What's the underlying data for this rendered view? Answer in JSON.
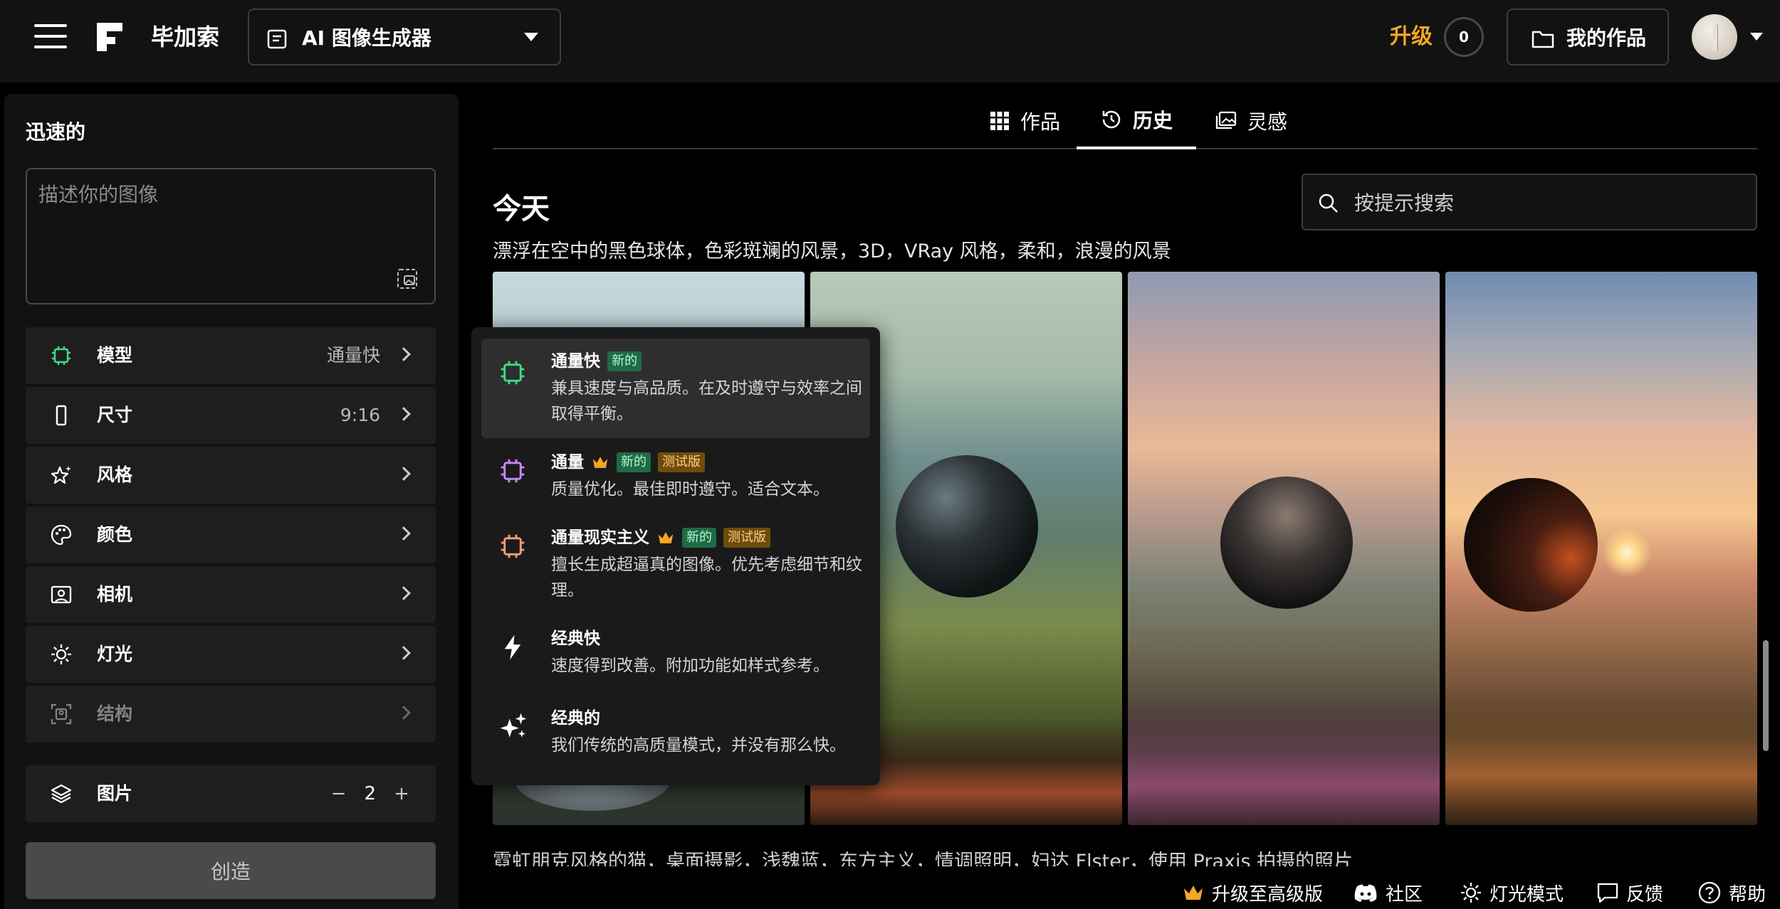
{
  "header": {
    "brand": "毕加索",
    "tool_selector": "AI 图像生成器",
    "upgrade": "升级",
    "credits": "0",
    "my_works": "我的作品"
  },
  "sidebar": {
    "title": "迅速的",
    "prompt_placeholder": "描述你的图像",
    "options": [
      {
        "label": "模型",
        "value": "通量快",
        "icon": "chip-icon"
      },
      {
        "label": "尺寸",
        "value": "9:16",
        "icon": "phone-portrait-icon"
      },
      {
        "label": "风格",
        "value": "",
        "icon": "star-sparkle-icon"
      },
      {
        "label": "颜色",
        "value": "",
        "icon": "palette-icon"
      },
      {
        "label": "相机",
        "value": "",
        "icon": "camera-portrait-icon"
      },
      {
        "label": "灯光",
        "value": "",
        "icon": "sun-icon"
      },
      {
        "label": "结构",
        "value": "",
        "icon": "structure-icon"
      }
    ],
    "images": {
      "label": "图片",
      "count": "2",
      "minus": "−",
      "plus": "+"
    },
    "create": "创造"
  },
  "main": {
    "tabs": [
      {
        "label": "作品",
        "icon": "grid-icon"
      },
      {
        "label": "历史",
        "icon": "history-icon",
        "active": true
      },
      {
        "label": "灵感",
        "icon": "image-gallery-icon"
      }
    ],
    "section_title": "今天",
    "search_placeholder": "按提示搜索",
    "prompt_caption": "漂浮在空中的黑色球体，色彩斑斓的风景，3D，VRay 风格，柔和，浪漫的风景",
    "next_caption": "霓虹朋克风格的猫，桌面摄影，浅魏蓝，东方主义，情调照明，妇达 Flster，使用 Praxis 拍摄的照片"
  },
  "model_dropdown": {
    "items": [
      {
        "title": "通量快",
        "badges": [
          "新的"
        ],
        "crown": false,
        "desc": "兼具速度与高品质。在及时遵守与效率之间取得平衡。",
        "icon": "chip-icon",
        "color": "#3ddc84",
        "selected": true
      },
      {
        "title": "通量",
        "badges": [
          "新的",
          "测试版"
        ],
        "crown": true,
        "desc": "质量优化。最佳即时遵守。适合文本。",
        "icon": "chip-icon",
        "color": "#c58af9"
      },
      {
        "title": "通量现实主义",
        "badges": [
          "新的",
          "测试版"
        ],
        "crown": true,
        "desc": "擅长生成超逼真的图像。优先考虑细节和纹理。",
        "icon": "chip-icon",
        "color": "#ff9b7a"
      },
      {
        "title": "经典快",
        "badges": [],
        "crown": false,
        "desc": "速度得到改善。附加功能如样式参考。",
        "icon": "bolt-icon",
        "color": "#ffffff"
      },
      {
        "title": "经典的",
        "badges": [],
        "crown": false,
        "desc": "我们传统的高质量模式，并没有那么快。",
        "icon": "sparkles-icon",
        "color": "#ffffff"
      }
    ]
  },
  "footer": {
    "upgrade_pro": "升级至高级版",
    "community": "社区",
    "light_mode": "灯光模式",
    "feedback": "反馈",
    "help": "帮助"
  },
  "colors": {
    "accent": "#f5a623",
    "panel": "#121212",
    "row": "#1e1e1e"
  }
}
